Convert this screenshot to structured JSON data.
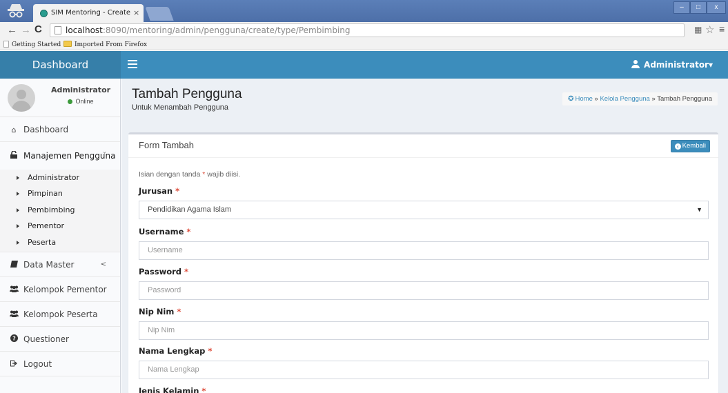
{
  "browser": {
    "tab_title": "SIM Mentoring - Create Peng",
    "tab_close": "×",
    "url_host": "localhost",
    "url_rest": ":8090/mentoring/admin/pengguna/create/type/Pembimbing",
    "bookmarks": [
      "Getting Started",
      "Imported From Firefox"
    ],
    "window_controls": {
      "min": "–",
      "max": "□",
      "close": "x"
    }
  },
  "app": {
    "brand": "Dashboard",
    "user_menu": "Administrator▾"
  },
  "sidebar": {
    "user_name": "Administrator",
    "user_status": "Online",
    "items": [
      {
        "label": "Dashboard",
        "icon": "home-icon",
        "glyph": "⌂"
      },
      {
        "label": "Manajemen Pengguna",
        "icon": "unlock-icon",
        "glyph": "⌠",
        "chevron": "˅"
      },
      {
        "label": "Data Master",
        "icon": "book-icon",
        "glyph": "▤",
        "chevron": "<"
      },
      {
        "label": "Kelompok Pementor",
        "icon": "group-icon",
        "glyph": "⚇"
      },
      {
        "label": "Kelompok Peserta",
        "icon": "group-icon",
        "glyph": "⚇"
      },
      {
        "label": "Questioner",
        "icon": "question-circle-icon",
        "glyph": "❓"
      },
      {
        "label": "Logout",
        "icon": "sign-out-icon",
        "glyph": "➥"
      }
    ],
    "submenu": [
      "Administrator",
      "Pimpinan",
      "Pembimbing",
      "Pementor",
      "Peserta"
    ]
  },
  "content": {
    "title": "Tambah Pengguna",
    "subtitle": "Untuk Menambah Pengguna",
    "breadcrumb": {
      "home": "Home",
      "sep": "»",
      "middle": "Kelola Pengguna",
      "current": "Tambah Pengguna"
    }
  },
  "form": {
    "box_title": "Form Tambah",
    "back_button": "Kembali",
    "hint_before": "Isian dengan tanda",
    "hint_star": "*",
    "hint_after": "wajib diisi.",
    "fields": [
      {
        "label": "Jurusan",
        "type": "select",
        "value": "Pendidikan Agama Islam"
      },
      {
        "label": "Username",
        "type": "text",
        "placeholder": "Username"
      },
      {
        "label": "Password",
        "type": "password",
        "placeholder": "Password"
      },
      {
        "label": "Nip Nim",
        "type": "text",
        "placeholder": "Nip Nim"
      },
      {
        "label": "Nama Lengkap",
        "type": "text",
        "placeholder": "Nama Lengkap"
      },
      {
        "label": "Jenis Kelamin",
        "type": "label-only"
      }
    ],
    "required_mark": "*"
  },
  "colors": {
    "brand_bg": "#367fa9",
    "navbar_bg": "#3c8dbc",
    "required": "#dd4b39",
    "content_bg": "#ecf0f5"
  }
}
